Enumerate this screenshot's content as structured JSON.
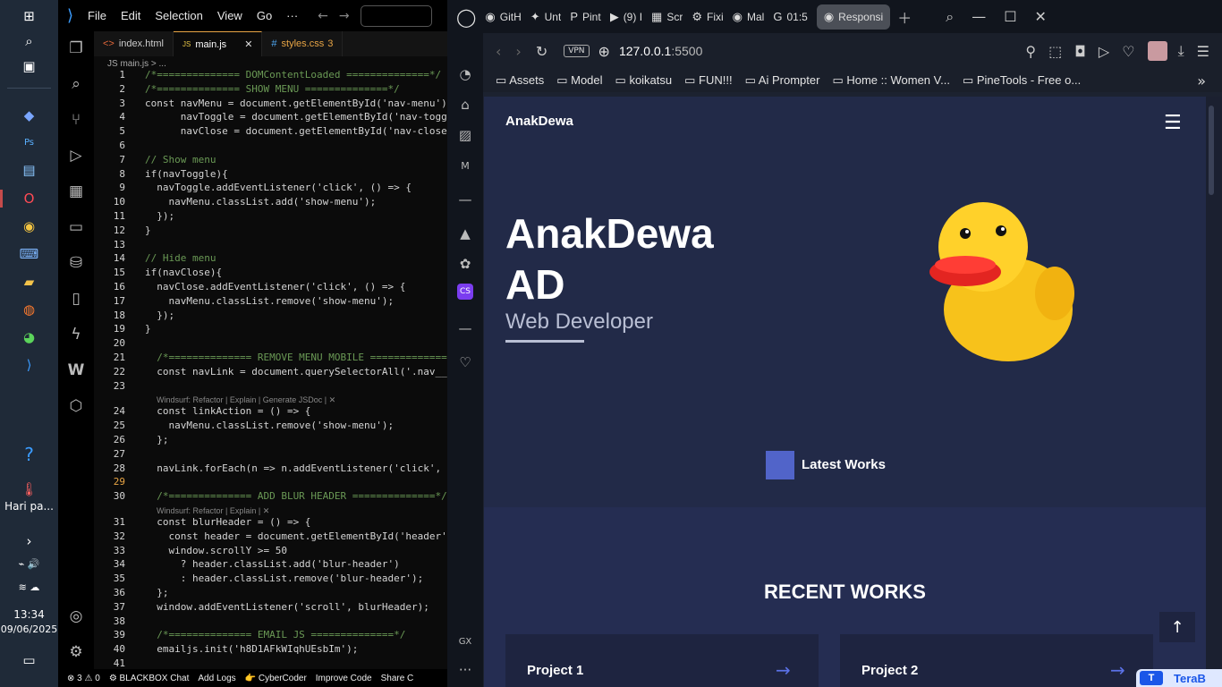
{
  "taskbar": {
    "time": "13:34",
    "date": "09/06/2025",
    "weather": "Hari pa...",
    "notif_count": "1"
  },
  "vscode": {
    "menu": [
      "File",
      "Edit",
      "Selection",
      "View",
      "Go",
      "···"
    ],
    "tabs": [
      {
        "label": "index.html",
        "icon": "<>"
      },
      {
        "label": "main.js",
        "icon": "JS"
      },
      {
        "label": "styles.css",
        "icon": "#",
        "badge": "3"
      }
    ],
    "breadcrumb": "JS main.js > ...",
    "lines": [
      {
        "n": "1",
        "t": "/*============== DOMContentLoaded ==============*/",
        "cls": "c"
      },
      {
        "n": "2",
        "t": "/*============== SHOW MENU ==============*/",
        "cls": "c"
      },
      {
        "n": "3",
        "t": "const navMenu = document.getElementById('nav-menu'),",
        "cls": ""
      },
      {
        "n": "4",
        "t": "      navToggle = document.getElementById('nav-toggle'",
        "cls": ""
      },
      {
        "n": "5",
        "t": "      navClose = document.getElementById('nav-close')",
        "cls": ""
      },
      {
        "n": "6",
        "t": "",
        "cls": ""
      },
      {
        "n": "7",
        "t": "// Show menu",
        "cls": "c"
      },
      {
        "n": "8",
        "t": "if(navToggle){",
        "cls": ""
      },
      {
        "n": "9",
        "t": "  navToggle.addEventListener('click', () => {",
        "cls": ""
      },
      {
        "n": "10",
        "t": "    navMenu.classList.add('show-menu');",
        "cls": ""
      },
      {
        "n": "11",
        "t": "  });",
        "cls": ""
      },
      {
        "n": "12",
        "t": "}",
        "cls": ""
      },
      {
        "n": "13",
        "t": "",
        "cls": ""
      },
      {
        "n": "14",
        "t": "// Hide menu",
        "cls": "c"
      },
      {
        "n": "15",
        "t": "if(navClose){",
        "cls": ""
      },
      {
        "n": "16",
        "t": "  navClose.addEventListener('click', () => {",
        "cls": ""
      },
      {
        "n": "17",
        "t": "    navMenu.classList.remove('show-menu');",
        "cls": ""
      },
      {
        "n": "18",
        "t": "  });",
        "cls": ""
      },
      {
        "n": "19",
        "t": "}",
        "cls": ""
      },
      {
        "n": "20",
        "t": "",
        "cls": ""
      },
      {
        "n": "21",
        "t": "  /*============== REMOVE MENU MOBILE ==============",
        "cls": "c"
      },
      {
        "n": "22",
        "t": "  const navLink = document.querySelectorAll('.nav__li",
        "cls": ""
      },
      {
        "n": "23",
        "t": "",
        "cls": ""
      },
      {
        "n": "24",
        "t": "  const linkAction = () => {",
        "cls": ""
      },
      {
        "n": "25",
        "t": "    navMenu.classList.remove('show-menu');",
        "cls": ""
      },
      {
        "n": "26",
        "t": "  };",
        "cls": ""
      },
      {
        "n": "27",
        "t": "",
        "cls": ""
      },
      {
        "n": "28",
        "t": "  navLink.forEach(n => n.addEventListener('click', li",
        "cls": ""
      },
      {
        "n": "29",
        "t": "",
        "cls": ""
      },
      {
        "n": "30",
        "t": "  /*============== ADD BLUR HEADER ==============*/",
        "cls": "c"
      },
      {
        "n": "31",
        "t": "  const blurHeader = () => {",
        "cls": ""
      },
      {
        "n": "32",
        "t": "    const header = document.getElementById('header');",
        "cls": ""
      },
      {
        "n": "33",
        "t": "    window.scrollY >= 50",
        "cls": ""
      },
      {
        "n": "34",
        "t": "      ? header.classList.add('blur-header')",
        "cls": ""
      },
      {
        "n": "35",
        "t": "      : header.classList.remove('blur-header');",
        "cls": ""
      },
      {
        "n": "36",
        "t": "  };",
        "cls": ""
      },
      {
        "n": "37",
        "t": "  window.addEventListener('scroll', blurHeader);",
        "cls": ""
      },
      {
        "n": "38",
        "t": "",
        "cls": ""
      },
      {
        "n": "39",
        "t": "  /*============== EMAIL JS ==============*/",
        "cls": "c"
      },
      {
        "n": "40",
        "t": "  emailjs.init('h8D1AFkWIqhUEsbIm');",
        "cls": ""
      },
      {
        "n": "41",
        "t": "",
        "cls": ""
      }
    ],
    "lens_labels": [
      "Windsurf: Refactor | Explain | Generate JSDoc | ✕",
      "Windsurf: Refactor | Explain | ✕"
    ],
    "status": [
      "⊗ 3 ⚠ 0",
      "⚙ BLACKBOX Chat",
      "Add Logs",
      "👉 CyberCoder",
      "Improve Code",
      "Share C"
    ]
  },
  "opera": {
    "tabs": [
      {
        "label": "GitH",
        "icon": "◉"
      },
      {
        "label": "Unt",
        "icon": "✦"
      },
      {
        "label": "Pint",
        "icon": "P"
      },
      {
        "label": "(9) I",
        "icon": "▶"
      },
      {
        "label": "Scr",
        "icon": "▦"
      },
      {
        "label": "Fixi",
        "icon": "⚙"
      },
      {
        "label": "Mal",
        "icon": "◉"
      },
      {
        "label": "01:5",
        "icon": "G"
      }
    ],
    "active_tab": "Responsi",
    "vpn": "VPN",
    "url_host": "127.0.0.1",
    "url_port": ":5500",
    "bookmarks": [
      "Assets",
      "Model",
      "koikatsu",
      "FUN!!!",
      "Ai Prompter",
      "Home :: Women V...",
      "PineTools - Free o..."
    ],
    "side_label": "GX"
  },
  "site": {
    "logo": "AnakDewa",
    "hero_line1": "AnakDewa",
    "hero_line2": "AD",
    "hero_role": "Web Developer",
    "latest_works": "Latest Works",
    "recent_title": "RECENT WORKS",
    "projects": [
      "Project 1",
      "Project 2"
    ],
    "accent": "#5164c9",
    "bg": "#222a48"
  },
  "corner_badge": "TeraB"
}
